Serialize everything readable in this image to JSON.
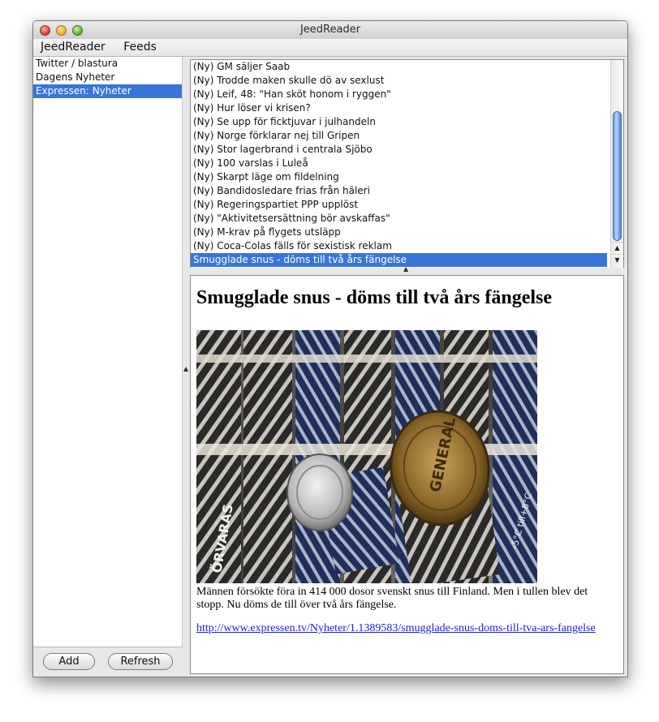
{
  "window": {
    "title": "JeedReader"
  },
  "menubar": {
    "items": [
      "JeedReader",
      "Feeds"
    ]
  },
  "sidebar": {
    "feeds": [
      "Twitter / blastura",
      "Dagens Nyheter",
      "Expressen: Nyheter"
    ],
    "selected_index": 2
  },
  "buttons": {
    "add": "Add",
    "refresh": "Refresh"
  },
  "articles": {
    "items": [
      "(Ny) GM säljer Saab",
      "(Ny) Trodde maken skulle dö av sexlust",
      "(Ny) Leif, 48: \"Han sköt honom i ryggen\"",
      "(Ny) Hur löser vi krisen?",
      "(Ny) Se upp för ficktjuvar i julhandeln",
      "(Ny) Norge förklarar nej till Gripen",
      "(Ny) Stor lagerbrand i centrala Sjöbo",
      "(Ny) 100 varslas i Luleå",
      "(Ny) Skarpt läge om fildelning",
      "(Ny) Bandidosledare frias från häleri",
      "(Ny) Regeringspartiet PPP upplöst",
      "(Ny) \"Aktivitetsersättning bör avskaffas\"",
      "(Ny) M-krav på flygets utsläpp",
      "(Ny) Coca-Colas fälls för sexistisk reklam",
      "Smugglade snus - döms till två års fängelse"
    ],
    "selected_index": 14
  },
  "article": {
    "title": "Smugglade snus - döms till två års fängelse",
    "body": "Männen försökte föra in 414 000 dosor svenskt snus till Finland. Men i tullen blev det stopp. Nu döms de till över två års fängelse.",
    "link": "http://www.expressen.tv/Nyheter/1.1389583/smugglade-snus-doms-till-tva-ars-fangelse"
  },
  "photo_labels": [
    "ÖRVARAS",
    "GENERAL",
    "-5°C till+8°C"
  ],
  "colors": {
    "selection": "#3875d7",
    "link": "#1a1ae6"
  }
}
